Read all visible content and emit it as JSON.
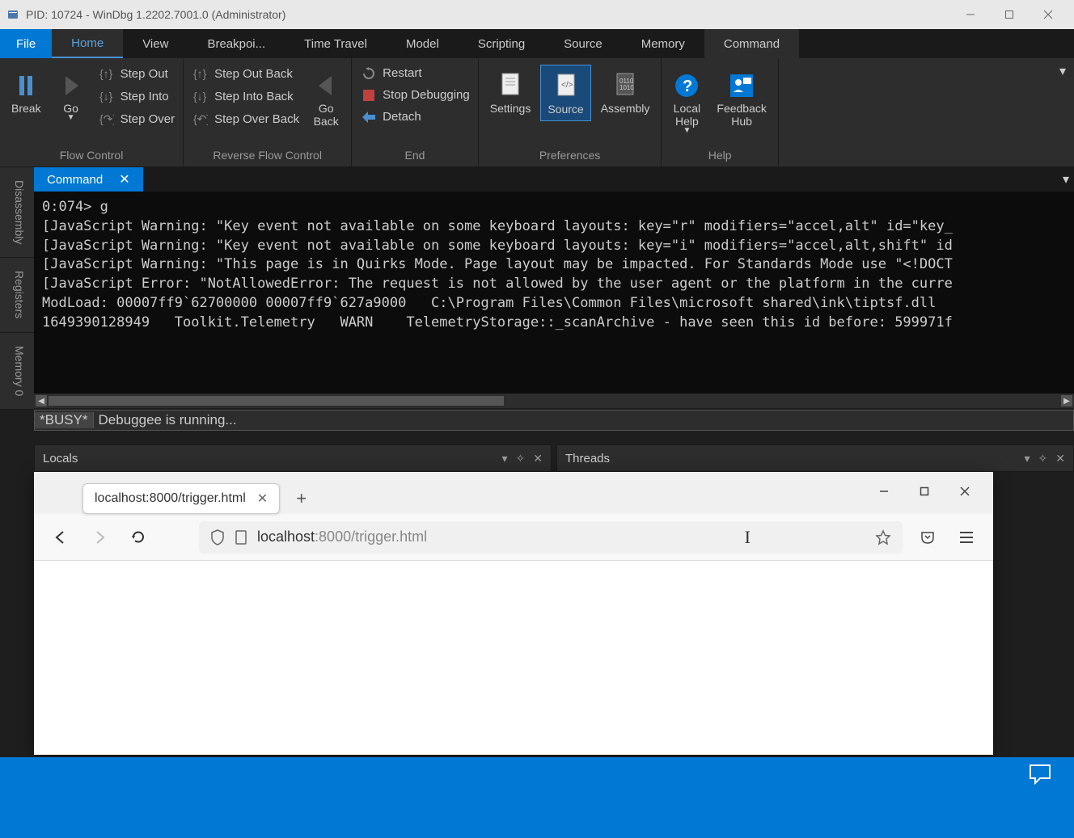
{
  "titlebar": {
    "title": "PID: 10724 - WinDbg 1.2202.7001.0 (Administrator)"
  },
  "menubar": {
    "items": [
      "File",
      "Home",
      "View",
      "Breakpoi...",
      "Time Travel",
      "Model",
      "Scripting",
      "Source",
      "Memory",
      "Command"
    ]
  },
  "ribbon": {
    "flow": {
      "label": "Flow Control",
      "break": "Break",
      "go": "Go",
      "step_out": "Step Out",
      "step_into": "Step Into",
      "step_over": "Step Over"
    },
    "reverse": {
      "label": "Reverse Flow Control",
      "go_back": "Go\nBack",
      "step_out_back": "Step Out Back",
      "step_into_back": "Step Into Back",
      "step_over_back": "Step Over Back"
    },
    "end": {
      "label": "End",
      "restart": "Restart",
      "stop": "Stop Debugging",
      "detach": "Detach"
    },
    "prefs": {
      "label": "Preferences",
      "settings": "Settings",
      "source": "Source",
      "assembly": "Assembly"
    },
    "help": {
      "label": "Help",
      "local": "Local\nHelp",
      "feedback": "Feedback\nHub"
    }
  },
  "sidebar": {
    "tabs": [
      "Disassembly",
      "Registers",
      "Memory 0"
    ]
  },
  "command": {
    "tab_label": "Command",
    "output": "0:074> g\n[JavaScript Warning: \"Key event not available on some keyboard layouts: key=\"r\" modifiers=\"accel,alt\" id=\"key_\n[JavaScript Warning: \"Key event not available on some keyboard layouts: key=\"i\" modifiers=\"accel,alt,shift\" id\n[JavaScript Warning: \"This page is in Quirks Mode. Page layout may be impacted. For Standards Mode use \"<!DOCT\n[JavaScript Error: \"NotAllowedError: The request is not allowed by the user agent or the platform in the curre\nModLoad: 00007ff9`62700000 00007ff9`627a9000   C:\\Program Files\\Common Files\\microsoft shared\\ink\\tiptsf.dll\n1649390128949   Toolkit.Telemetry   WARN    TelemetryStorage::_scanArchive - have seen this id before: 599971f",
    "status_busy": "*BUSY*",
    "status_msg": "Debuggee is running..."
  },
  "panels": {
    "locals": "Locals",
    "threads": "Threads"
  },
  "browser": {
    "tab_title": "localhost:8000/trigger.html",
    "url_host": "localhost",
    "url_path": ":8000/trigger.html"
  }
}
